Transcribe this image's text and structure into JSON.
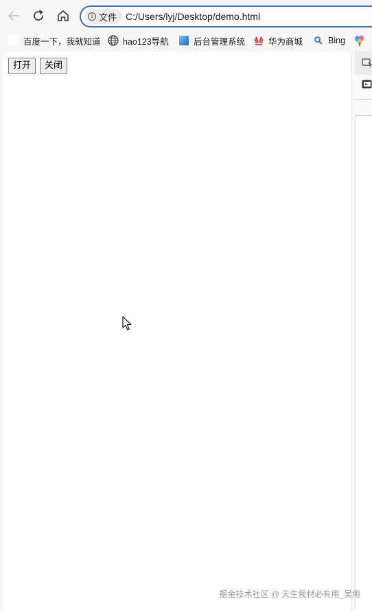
{
  "navbar": {
    "site_info_label": "文件",
    "url": "C:/Users/lyj/Desktop/demo.html",
    "icons": [
      "back-arrow-icon",
      "reload-icon",
      "home-icon",
      "info-icon"
    ]
  },
  "bookmarks": [
    {
      "label": "百度一下，我就知道",
      "icon": "blank-page-icon"
    },
    {
      "label": "hao123导航",
      "icon": "globe-icon"
    },
    {
      "label": "后台管理系统",
      "icon": "blue-gradient-icon"
    },
    {
      "label": "华为商城",
      "icon": "huawei-logo-icon"
    },
    {
      "label": "Bing",
      "icon": "search-icon"
    }
  ],
  "page": {
    "open_button": "打开",
    "close_button": "关闭"
  },
  "watermark": "掘金技术社区 @ 天生我材必有用_吴用",
  "colors": {
    "address_border": "#3b6fc9",
    "chrome_bg": "#f7f7f7",
    "page_bg": "#ffffff"
  }
}
